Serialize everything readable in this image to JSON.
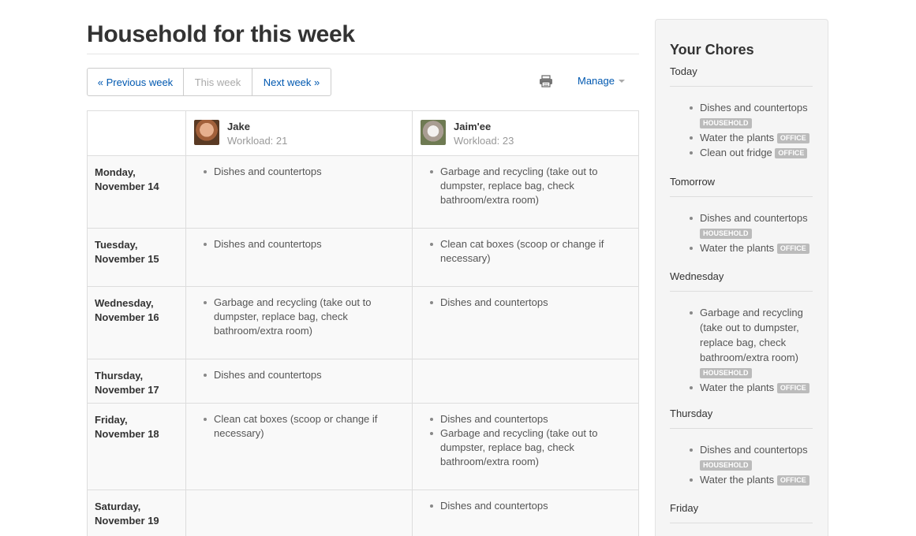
{
  "page": {
    "title": "Household for this week"
  },
  "week_nav": {
    "previous": "« Previous week",
    "current": "This week",
    "next": "Next week »"
  },
  "toolbar": {
    "print_icon": "printer-icon",
    "manage_label": "Manage"
  },
  "people": [
    {
      "name": "Jake",
      "workload": "Workload: 21",
      "avatar": "avatar"
    },
    {
      "name": "Jaim'ee",
      "workload": "Workload: 23",
      "avatar": "avatar"
    }
  ],
  "days": [
    {
      "weekday": "Monday,",
      "date": "November 14",
      "jake": [
        "Dishes and countertops"
      ],
      "jaimee": [
        "Garbage and recycling (take out to dumpster, replace bag, check bathroom/extra room)"
      ]
    },
    {
      "weekday": "Tuesday,",
      "date": "November 15",
      "jake": [
        "Dishes and countertops"
      ],
      "jaimee": [
        "Clean cat boxes (scoop or change if necessary)"
      ]
    },
    {
      "weekday": "Wednesday,",
      "date": "November 16",
      "jake": [
        "Garbage and recycling (take out to dumpster, replace bag, check bathroom/extra room)"
      ],
      "jaimee": [
        "Dishes and countertops"
      ]
    },
    {
      "weekday": "Thursday,",
      "date": "November 17",
      "jake": [
        "Dishes and countertops"
      ],
      "jaimee": []
    },
    {
      "weekday": "Friday,",
      "date": "November 18",
      "jake": [
        "Clean cat boxes (scoop or change if necessary)"
      ],
      "jaimee": [
        "Dishes and countertops",
        "Garbage and recycling (take out to dumpster, replace bag, check bathroom/extra room)"
      ]
    },
    {
      "weekday": "Saturday,",
      "date": "November 19",
      "jake": [],
      "jaimee": [
        "Dishes and countertops"
      ]
    }
  ],
  "sidebar": {
    "title": "Your Chores",
    "sections": [
      {
        "day": "Today",
        "items": [
          {
            "text": "Dishes and countertops",
            "tag": "HOUSEHOLD"
          },
          {
            "text": "Water the plants",
            "tag": "OFFICE"
          },
          {
            "text": "Clean out fridge",
            "tag": "OFFICE"
          }
        ]
      },
      {
        "day": "Tomorrow",
        "items": [
          {
            "text": "Dishes and countertops",
            "tag": "HOUSEHOLD"
          },
          {
            "text": "Water the plants",
            "tag": "OFFICE"
          }
        ]
      },
      {
        "day": "Wednesday",
        "items": [
          {
            "text": "Garbage and recycling (take out to dumpster, replace bag, check bathroom/extra room)",
            "tag": "HOUSEHOLD"
          },
          {
            "text": "Water the plants",
            "tag": "OFFICE"
          }
        ]
      },
      {
        "day": "Thursday",
        "items": [
          {
            "text": "Dishes and countertops",
            "tag": "HOUSEHOLD"
          },
          {
            "text": "Water the plants",
            "tag": "OFFICE"
          }
        ]
      },
      {
        "day": "Friday",
        "items": []
      }
    ]
  },
  "colors": {
    "link": "#0058b0",
    "tag_bg": "#bbbbbb",
    "row_bg": "#f9f9f9",
    "sidebar_bg": "#f5f5f5"
  }
}
